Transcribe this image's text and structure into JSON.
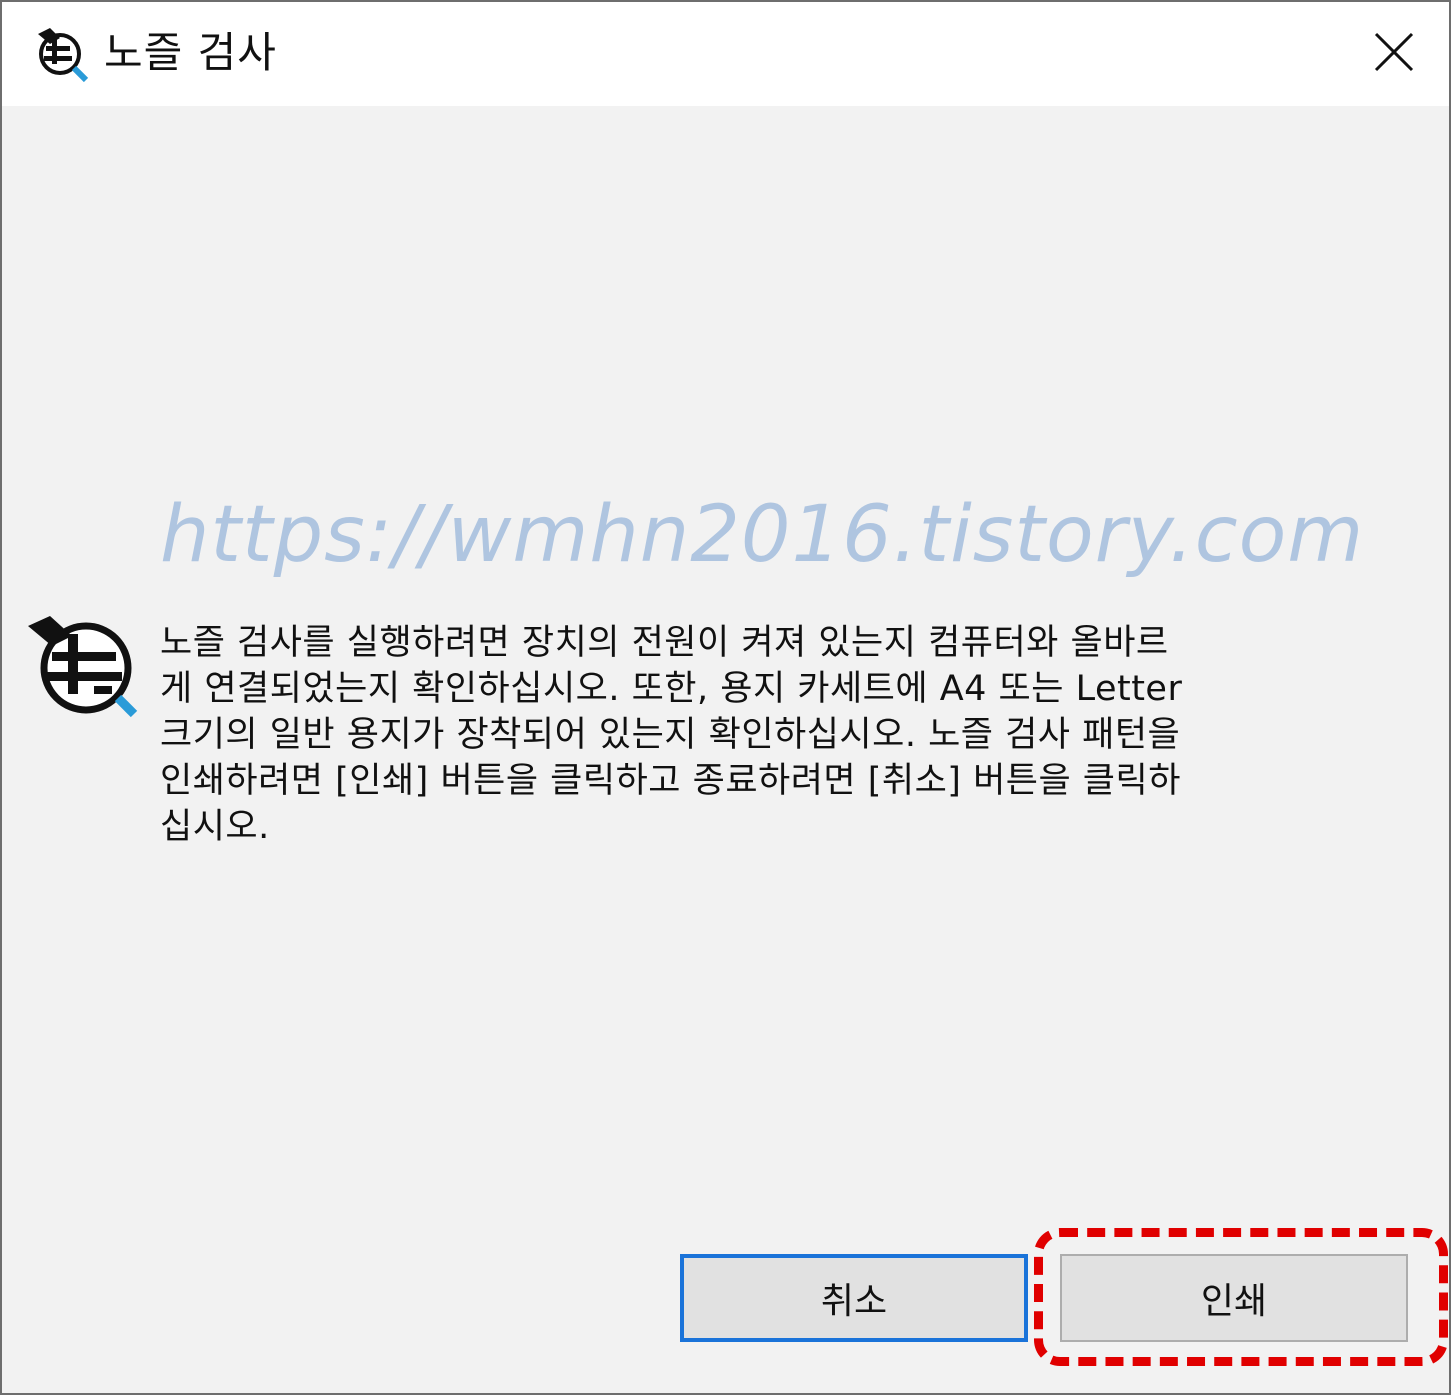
{
  "dialog": {
    "title": "노즐 검사",
    "title_icon": "nozzle-check-icon",
    "close_icon": "close-icon"
  },
  "watermark": "https://wmhn2016.tistory.com",
  "body": {
    "icon": "nozzle-check-icon",
    "lines": [
      "노즐 검사를 실행하려면 장치의 전원이 켜져 있는지 컴퓨터와 올바르",
      "게 연결되었는지 확인하십시오. 또한, 용지 카세트에 A4 또는 Letter",
      "크기의 일반 용지가 장착되어 있는지 확인하십시오. 노즐 검사 패턴을",
      "인쇄하려면 [인쇄] 버튼을 클릭하고 종료하려면 [취소] 버튼을 클릭하",
      "십시오."
    ]
  },
  "buttons": {
    "cancel_label": "취소",
    "print_label": "인쇄"
  },
  "colors": {
    "accent": "#1a73d9",
    "highlight": "#e00000"
  }
}
